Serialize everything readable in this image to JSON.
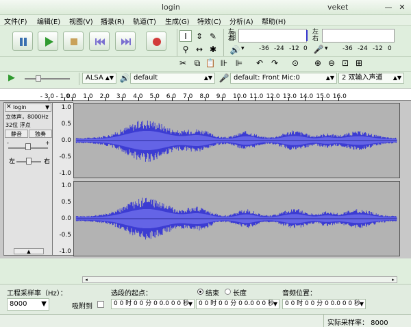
{
  "window": {
    "title": "login",
    "right_title": "veket",
    "minimize": "—",
    "close": "✕"
  },
  "menu": [
    "文件(F)",
    "编辑(E)",
    "视图(V)",
    "播录(R)",
    "轨道(T)",
    "生成(G)",
    "特效(C)",
    "分析(A)",
    "帮助(H)"
  ],
  "meter": {
    "left": "左",
    "right": "右",
    "ticks": [
      "-36",
      "-24",
      "-12",
      "0"
    ]
  },
  "device": {
    "host": "ALSA",
    "output": "default",
    "input": "default: Front Mic:0",
    "channels": "2 双输入声道"
  },
  "ruler": {
    "ticks": [
      "- 3.0",
      "- 1.0",
      "0.0",
      "1.0",
      "2.0",
      "3.0",
      "4.0",
      "5.0",
      "6.0",
      "7.0",
      "8.0",
      "9.0",
      "10.0",
      "11.0",
      "12.0",
      "13.0",
      "14.0",
      "15.0",
      "16.0"
    ]
  },
  "track": {
    "name": "login",
    "info1": "立体声，8000Hz",
    "info2": "32位 浮点",
    "mute": "静音",
    "solo": "独奏",
    "pan_left": "左",
    "pan_right": "右",
    "gain_minus": "-",
    "gain_plus": "+"
  },
  "scale_top": [
    "1.0",
    "0.5",
    "0.0",
    "-0.5",
    "-1.0"
  ],
  "scale_bottom": [
    "1.0",
    "0.5",
    "0.0",
    "-0.5",
    "-1.0"
  ],
  "bottom": {
    "rate_label": "工程采样率（Hz）：",
    "rate_value": "8000",
    "snap_label": "吸附到",
    "start_label": "选段的起点：",
    "end_label": "结束",
    "length_label": "长度",
    "pos_label": "音频位置：",
    "time_value": "0 0 时 0 0 分 0 0.0 0 0 秒"
  },
  "status": {
    "rate": "实际采样率： 8000"
  },
  "colors": {
    "wave": "#3c3cd2",
    "wave_light": "#6464e6",
    "bg": "#dfeedd"
  }
}
